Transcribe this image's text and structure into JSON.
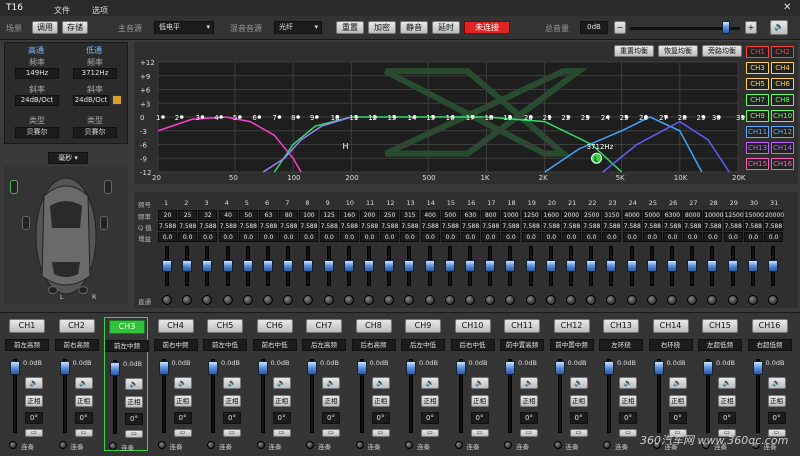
{
  "window": {
    "title": "T16",
    "close": "✕"
  },
  "menu": {
    "scene": "场景",
    "call": "调用",
    "save": "存储",
    "file": "文件",
    "options": "选项"
  },
  "top": {
    "main_source_label": "主音源",
    "main_source_value": "低电平",
    "mix_source_label": "混音音源",
    "mix_source_value": "光纤",
    "btn_reset": "重置",
    "btn_encrypt": "加密",
    "btn_mute": "静音",
    "btn_delay": "延时",
    "btn_connect": "未连接",
    "master_label": "总音量",
    "master_value": "0dB",
    "minus": "−",
    "plus": "+",
    "speaker_icon": "speaker-icon"
  },
  "filters": {
    "hp_title": "高通",
    "lp_title": "低通",
    "freq_label": "频率",
    "hp_freq": "149Hz",
    "lp_freq": "3712Hz",
    "slope_label": "斜率",
    "hp_slope": "24dB/Oct",
    "lp_slope": "24dB/Oct",
    "type_label": "类型",
    "hp_type": "贝赛尔",
    "lp_type": "贝赛尔",
    "time_unit": "毫秒"
  },
  "car": {
    "left": "L",
    "right": "R"
  },
  "eq_buttons": {
    "reset": "重置均衡",
    "restore": "恢复均衡",
    "bypass": "旁路均衡"
  },
  "ch_select": [
    "CH1",
    "CH2",
    "CH3",
    "CH4",
    "CH5",
    "CH6",
    "CH7",
    "CH8",
    "CH9",
    "CH10",
    "CH11",
    "CH12",
    "CH13",
    "CH14",
    "CH15",
    "CH16"
  ],
  "ch_colors": [
    "#ff4040",
    "#ff4040",
    "#ffd24a",
    "#ffd24a",
    "#ffd24a",
    "#ffd24a",
    "#5cff5c",
    "#5cff5c",
    "#5cff5c",
    "#5cff5c",
    "#5aaaff",
    "#5aaaff",
    "#c060ff",
    "#c060ff",
    "#ff60c0",
    "#ff60c0"
  ],
  "chart_data": {
    "type": "line",
    "title": "",
    "xlabel": "",
    "ylabel": "",
    "ylim": [
      -12,
      12
    ],
    "yticks": [
      "+12",
      "+9",
      "+6",
      "+3",
      "0",
      "-3",
      "-6",
      "-9",
      "-12"
    ],
    "xticks": [
      "20",
      "50",
      "100",
      "200",
      "500",
      "1K",
      "2K",
      "5K",
      "10K",
      "20K"
    ],
    "band_markers": [
      "1",
      "2",
      "3",
      "4",
      "5",
      "6",
      "7",
      "8",
      "9",
      "10",
      "11",
      "12",
      "13",
      "14",
      "15",
      "16",
      "17",
      "18",
      "19",
      "20",
      "21",
      "22",
      "23",
      "24",
      "25",
      "26",
      "27",
      "28",
      "29",
      "30",
      "31"
    ],
    "annotations": {
      "h_marker": "H",
      "l_marker": "L",
      "l_freq": "3712Hz"
    },
    "series": [
      {
        "color": "#ff3ed0",
        "x": [
          20,
          30,
          45,
          60,
          80,
          100,
          110
        ],
        "y": [
          -3,
          -0.5,
          0,
          -1,
          -4,
          -9,
          -12
        ]
      },
      {
        "color": "#2ee06a",
        "x": [
          80,
          100,
          130,
          200,
          500,
          1000,
          2000,
          3500,
          5000
        ],
        "y": [
          -12,
          -6,
          -2,
          0,
          0,
          0,
          -1,
          -6,
          -12
        ]
      },
      {
        "color": "#a07aff",
        "x": [
          70,
          90,
          110,
          140,
          200
        ],
        "y": [
          -12,
          -9,
          -5,
          -2,
          0
        ]
      },
      {
        "color": "#3aa8ff",
        "x": [
          2000,
          3000,
          5000,
          7000,
          10000,
          13000
        ],
        "y": [
          -12,
          -7,
          -3,
          0,
          -3,
          -12
        ]
      },
      {
        "color": "#6060ff",
        "x": [
          4000,
          6000,
          10000,
          14000,
          18000
        ],
        "y": [
          -12,
          -6,
          -1,
          -5,
          -12
        ]
      }
    ]
  },
  "bands": {
    "row_labels": {
      "num": "频号",
      "freq": "频率",
      "q": "Q 值",
      "gain": "增益"
    },
    "freqs": [
      "20",
      "25",
      "32",
      "40",
      "50",
      "63",
      "80",
      "100",
      "125",
      "160",
      "200",
      "250",
      "315",
      "400",
      "500",
      "630",
      "800",
      "1000",
      "1250",
      "1600",
      "2000",
      "2500",
      "3150",
      "4000",
      "5000",
      "6300",
      "8000",
      "10000",
      "12500",
      "15000",
      "20000"
    ],
    "q": "7.588",
    "gain": "0.0",
    "pass": "直通"
  },
  "strips": [
    {
      "ch": "CH1",
      "name": "前左高频"
    },
    {
      "ch": "CH2",
      "name": "前右高频"
    },
    {
      "ch": "CH3",
      "name": "前左中频"
    },
    {
      "ch": "CH4",
      "name": "前右中频"
    },
    {
      "ch": "CH5",
      "name": "前左中低"
    },
    {
      "ch": "CH6",
      "name": "前右中低"
    },
    {
      "ch": "CH7",
      "name": "后左高频"
    },
    {
      "ch": "CH8",
      "name": "后右高频"
    },
    {
      "ch": "CH9",
      "name": "后左中低"
    },
    {
      "ch": "CH10",
      "name": "后右中低"
    },
    {
      "ch": "CH11",
      "name": "前中置高频"
    },
    {
      "ch": "CH12",
      "name": "前中置中频"
    },
    {
      "ch": "CH13",
      "name": "左环绕"
    },
    {
      "ch": "CH14",
      "name": "右环绕"
    },
    {
      "ch": "CH15",
      "name": "左超低频"
    },
    {
      "ch": "CH16",
      "name": "右超低频"
    }
  ],
  "strip_common": {
    "level": "0.0dB",
    "phase": "正相",
    "angle": "0°",
    "link": "连奏"
  },
  "watermark": "360汽车网 www.360qc.com"
}
